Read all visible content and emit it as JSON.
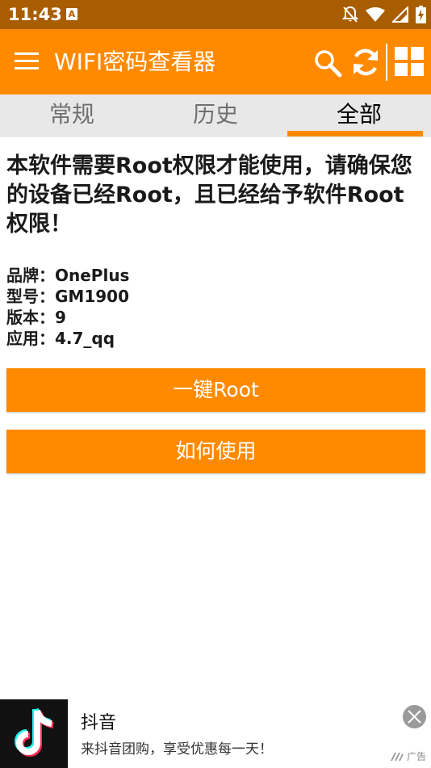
{
  "status_bar": {
    "time": "11:43",
    "notification_badge": "A",
    "icons": [
      "notifications-off-icon",
      "wifi-icon",
      "cellular-signal-icon",
      "battery-charging-icon"
    ]
  },
  "app_bar": {
    "title": "WIFI密码查看器",
    "icons": [
      "menu-icon",
      "search-icon",
      "refresh-icon",
      "grid-view-icon"
    ]
  },
  "tabs": [
    {
      "label": "常规",
      "active": false
    },
    {
      "label": "历史",
      "active": false
    },
    {
      "label": "全部",
      "active": true
    }
  ],
  "content": {
    "notice": "本软件需要Root权限才能使用，请确保您的设备已经Root，且已经给予软件Root权限！",
    "info": [
      "品牌：OnePlus",
      "型号：GM1900",
      "版本：9",
      "应用：4.7_qq"
    ],
    "buttons": {
      "root": "一键Root",
      "how_to_use": "如何使用"
    }
  },
  "ad": {
    "title": "抖音",
    "subtitle": "来抖音团购，享受优惠每一天！",
    "label": "广告"
  },
  "colors": {
    "accent": "#ff8a00",
    "status_bar": "#a85d00",
    "tab_bar": "#e8e8e8"
  }
}
